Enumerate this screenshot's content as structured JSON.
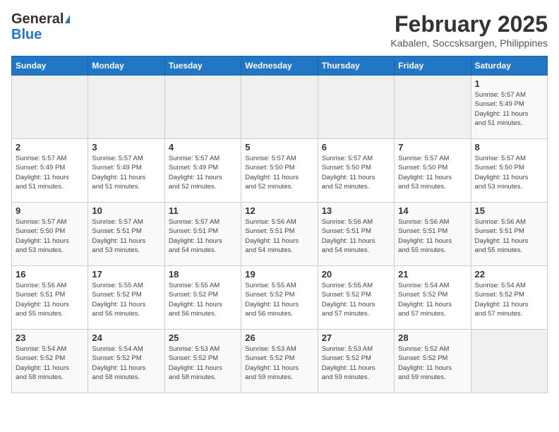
{
  "header": {
    "logo_general": "General",
    "logo_blue": "Blue",
    "title": "February 2025",
    "subtitle": "Kabalen, Soccsksargen, Philippines"
  },
  "days_of_week": [
    "Sunday",
    "Monday",
    "Tuesday",
    "Wednesday",
    "Thursday",
    "Friday",
    "Saturday"
  ],
  "weeks": [
    [
      {
        "day": "",
        "info": ""
      },
      {
        "day": "",
        "info": ""
      },
      {
        "day": "",
        "info": ""
      },
      {
        "day": "",
        "info": ""
      },
      {
        "day": "",
        "info": ""
      },
      {
        "day": "",
        "info": ""
      },
      {
        "day": "1",
        "info": "Sunrise: 5:57 AM\nSunset: 5:49 PM\nDaylight: 11 hours\nand 51 minutes."
      }
    ],
    [
      {
        "day": "2",
        "info": "Sunrise: 5:57 AM\nSunset: 5:49 PM\nDaylight: 11 hours\nand 51 minutes."
      },
      {
        "day": "3",
        "info": "Sunrise: 5:57 AM\nSunset: 5:49 PM\nDaylight: 11 hours\nand 51 minutes."
      },
      {
        "day": "4",
        "info": "Sunrise: 5:57 AM\nSunset: 5:49 PM\nDaylight: 11 hours\nand 52 minutes."
      },
      {
        "day": "5",
        "info": "Sunrise: 5:57 AM\nSunset: 5:50 PM\nDaylight: 11 hours\nand 52 minutes."
      },
      {
        "day": "6",
        "info": "Sunrise: 5:57 AM\nSunset: 5:50 PM\nDaylight: 11 hours\nand 52 minutes."
      },
      {
        "day": "7",
        "info": "Sunrise: 5:57 AM\nSunset: 5:50 PM\nDaylight: 11 hours\nand 53 minutes."
      },
      {
        "day": "8",
        "info": "Sunrise: 5:57 AM\nSunset: 5:50 PM\nDaylight: 11 hours\nand 53 minutes."
      }
    ],
    [
      {
        "day": "9",
        "info": "Sunrise: 5:57 AM\nSunset: 5:50 PM\nDaylight: 11 hours\nand 53 minutes."
      },
      {
        "day": "10",
        "info": "Sunrise: 5:57 AM\nSunset: 5:51 PM\nDaylight: 11 hours\nand 53 minutes."
      },
      {
        "day": "11",
        "info": "Sunrise: 5:57 AM\nSunset: 5:51 PM\nDaylight: 11 hours\nand 54 minutes."
      },
      {
        "day": "12",
        "info": "Sunrise: 5:56 AM\nSunset: 5:51 PM\nDaylight: 11 hours\nand 54 minutes."
      },
      {
        "day": "13",
        "info": "Sunrise: 5:56 AM\nSunset: 5:51 PM\nDaylight: 11 hours\nand 54 minutes."
      },
      {
        "day": "14",
        "info": "Sunrise: 5:56 AM\nSunset: 5:51 PM\nDaylight: 11 hours\nand 55 minutes."
      },
      {
        "day": "15",
        "info": "Sunrise: 5:56 AM\nSunset: 5:51 PM\nDaylight: 11 hours\nand 55 minutes."
      }
    ],
    [
      {
        "day": "16",
        "info": "Sunrise: 5:56 AM\nSunset: 5:51 PM\nDaylight: 11 hours\nand 55 minutes."
      },
      {
        "day": "17",
        "info": "Sunrise: 5:55 AM\nSunset: 5:52 PM\nDaylight: 11 hours\nand 56 minutes."
      },
      {
        "day": "18",
        "info": "Sunrise: 5:55 AM\nSunset: 5:52 PM\nDaylight: 11 hours\nand 56 minutes."
      },
      {
        "day": "19",
        "info": "Sunrise: 5:55 AM\nSunset: 5:52 PM\nDaylight: 11 hours\nand 56 minutes."
      },
      {
        "day": "20",
        "info": "Sunrise: 5:55 AM\nSunset: 5:52 PM\nDaylight: 11 hours\nand 57 minutes."
      },
      {
        "day": "21",
        "info": "Sunrise: 5:54 AM\nSunset: 5:52 PM\nDaylight: 11 hours\nand 57 minutes."
      },
      {
        "day": "22",
        "info": "Sunrise: 5:54 AM\nSunset: 5:52 PM\nDaylight: 11 hours\nand 57 minutes."
      }
    ],
    [
      {
        "day": "23",
        "info": "Sunrise: 5:54 AM\nSunset: 5:52 PM\nDaylight: 11 hours\nand 58 minutes."
      },
      {
        "day": "24",
        "info": "Sunrise: 5:54 AM\nSunset: 5:52 PM\nDaylight: 11 hours\nand 58 minutes."
      },
      {
        "day": "25",
        "info": "Sunrise: 5:53 AM\nSunset: 5:52 PM\nDaylight: 11 hours\nand 58 minutes."
      },
      {
        "day": "26",
        "info": "Sunrise: 5:53 AM\nSunset: 5:52 PM\nDaylight: 11 hours\nand 59 minutes."
      },
      {
        "day": "27",
        "info": "Sunrise: 5:53 AM\nSunset: 5:52 PM\nDaylight: 11 hours\nand 59 minutes."
      },
      {
        "day": "28",
        "info": "Sunrise: 5:52 AM\nSunset: 5:52 PM\nDaylight: 11 hours\nand 59 minutes."
      },
      {
        "day": "",
        "info": ""
      }
    ]
  ]
}
